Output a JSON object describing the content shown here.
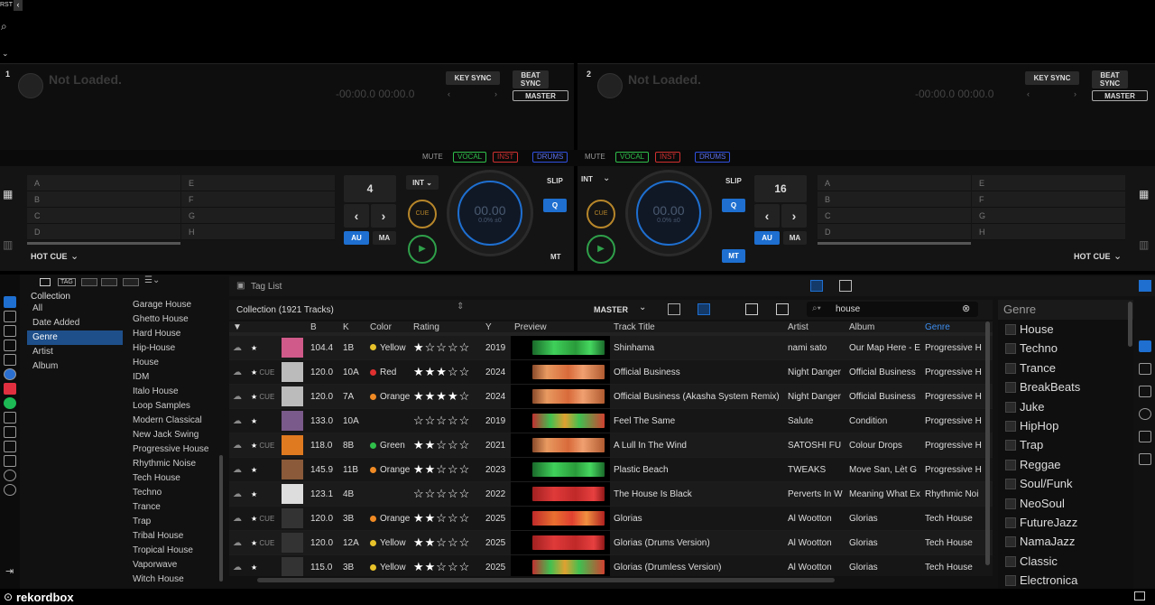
{
  "app": {
    "name": "rekordbox",
    "top_label": "RST"
  },
  "decks": [
    {
      "num": "1",
      "status": "Not Loaded.",
      "time": "-00:00.0 00:00.0",
      "key_sync": "KEY SYNC",
      "beat_sync": "BEAT SYNC",
      "master": "MASTER",
      "loop": "4",
      "bpm": "00.00",
      "pitch": "0.0% ±0",
      "int": "INT",
      "slip": "SLIP",
      "q": "Q",
      "au": "AU",
      "ma": "MA",
      "mt": "MT",
      "cue": "CUE",
      "hot_cue": "HOT CUE",
      "pads_left": [
        "A",
        "B",
        "C",
        "D"
      ],
      "pads_right": [
        "E",
        "F",
        "G",
        "H"
      ]
    },
    {
      "num": "2",
      "status": "Not Loaded.",
      "time": "-00:00.0 00:00.0",
      "key_sync": "KEY SYNC",
      "beat_sync": "BEAT SYNC",
      "master": "MASTER",
      "loop": "16",
      "bpm": "00.00",
      "pitch": "0.0% ±0",
      "int": "INT",
      "slip": "SLIP",
      "q": "Q",
      "au": "AU",
      "ma": "MA",
      "mt": "MT",
      "cue": "CUE",
      "hot_cue": "HOT CUE",
      "pads_left": [
        "A",
        "B",
        "C",
        "D"
      ],
      "pads_right": [
        "E",
        "F",
        "G",
        "H"
      ]
    }
  ],
  "mixer": {
    "mute": "MUTE",
    "vocal": "VOCAL",
    "inst": "INST",
    "drums": "DRUMS",
    "colors": {
      "vocal": "#2fbf4a",
      "inst": "#d03030",
      "drums": "#3050e0"
    }
  },
  "browser": {
    "tag_list": "Tag List",
    "tag_label": "TAG",
    "collection_root": "Collection",
    "tree": [
      "All",
      "Date Added",
      "Genre",
      "Artist",
      "Album"
    ],
    "genres_col": [
      "Garage House",
      "Ghetto House",
      "Hard House",
      "Hip-House",
      "House",
      "IDM",
      "Italo House",
      "Loop Samples",
      "Modern Classical",
      "New Jack Swing",
      "Progressive House",
      "Rhythmic Noise",
      "Tech House",
      "Techno",
      "Trance",
      "Trap",
      "Tribal House",
      "Tropical House",
      "Vaporwave",
      "Witch House"
    ],
    "collection_title": "Collection (1921 Tracks)",
    "master_label": "MASTER",
    "search_value": "house",
    "columns": [
      "B",
      "K",
      "Color",
      "Rating",
      "Y",
      "Preview",
      "Track Title",
      "Artist",
      "Album",
      "Genre"
    ],
    "rows": [
      {
        "bpm": "104.4",
        "key": "1B",
        "color": "Yellow",
        "colorhex": "#e8c22a",
        "rating": 1,
        "year": "2019",
        "title": "Shinhama",
        "artist": "nami sato",
        "album": "Our Map Here - E",
        "genre": "Progressive H",
        "cue": "",
        "art": "#d05a8a",
        "wave": "green"
      },
      {
        "bpm": "120.0",
        "key": "10A",
        "color": "Red",
        "colorhex": "#e03030",
        "rating": 3,
        "year": "2024",
        "title": "Official Business",
        "artist": "Night Danger",
        "album": "Official Business",
        "genre": "Progressive H",
        "cue": "CUE",
        "art": "#bbbbbb",
        "wave": "orange"
      },
      {
        "bpm": "120.0",
        "key": "7A",
        "color": "Orange",
        "colorhex": "#f08a24",
        "rating": 4,
        "year": "2024",
        "title": "Official Business (Akasha System Remix)",
        "artist": "Night Danger",
        "album": "Official Business",
        "genre": "Progressive H",
        "cue": "CUE",
        "art": "#bbbbbb",
        "wave": "orange"
      },
      {
        "bpm": "133.0",
        "key": "10A",
        "color": "",
        "colorhex": "",
        "rating": 0,
        "year": "2019",
        "title": "Feel The Same",
        "artist": "Salute",
        "album": "Condition",
        "genre": "Progressive H",
        "cue": "",
        "art": "#7a5a8a",
        "wave": "mixed"
      },
      {
        "bpm": "118.0",
        "key": "8B",
        "color": "Green",
        "colorhex": "#2fbf4a",
        "rating": 2,
        "year": "2021",
        "title": "A Lull In The Wind",
        "artist": "SATOSHI FU",
        "album": "Colour Drops",
        "genre": "Progressive H",
        "cue": "CUE",
        "art": "#e07a20",
        "wave": "orange"
      },
      {
        "bpm": "145.9",
        "key": "11B",
        "color": "Orange",
        "colorhex": "#f08a24",
        "rating": 2,
        "year": "2023",
        "title": "Plastic Beach",
        "artist": "TWEAKS",
        "album": "Move San, Lèt G",
        "genre": "Progressive H",
        "cue": "",
        "art": "#8a5a3a",
        "wave": "green"
      },
      {
        "bpm": "123.1",
        "key": "4B",
        "color": "",
        "colorhex": "",
        "rating": 0,
        "year": "2022",
        "title": "The House Is Black",
        "artist": "Perverts In W",
        "album": "Meaning What Ex",
        "genre": "Rhythmic Noi",
        "cue": "",
        "art": "#dddddd",
        "wave": "red"
      },
      {
        "bpm": "120.0",
        "key": "3B",
        "color": "Orange",
        "colorhex": "#f08a24",
        "rating": 2,
        "year": "2025",
        "title": "Glorias",
        "artist": "Al Wootton",
        "album": "Glorias",
        "genre": "Tech House",
        "cue": "CUE",
        "art": "#333333",
        "wave": "redorange"
      },
      {
        "bpm": "120.0",
        "key": "12A",
        "color": "Yellow",
        "colorhex": "#e8c22a",
        "rating": 2,
        "year": "2025",
        "title": "Glorias (Drums Version)",
        "artist": "Al Wootton",
        "album": "Glorias",
        "genre": "Tech House",
        "cue": "CUE",
        "art": "#333333",
        "wave": "red"
      },
      {
        "bpm": "115.0",
        "key": "3B",
        "color": "Yellow",
        "colorhex": "#e8c22a",
        "rating": 2,
        "year": "2025",
        "title": "Glorias (Drumless Version)",
        "artist": "Al Wootton",
        "album": "Glorias",
        "genre": "Tech House",
        "cue": "",
        "art": "#333333",
        "wave": "mixed"
      }
    ],
    "genre_panel_title": "Genre",
    "genre_panel": [
      "House",
      "Techno",
      "Trance",
      "BreakBeats",
      "Juke",
      "HipHop",
      "Trap",
      "Reggae",
      "Soul/Funk",
      "NeoSoul",
      "FutureJazz",
      "NamaJazz",
      "Classic",
      "Electronica"
    ]
  }
}
